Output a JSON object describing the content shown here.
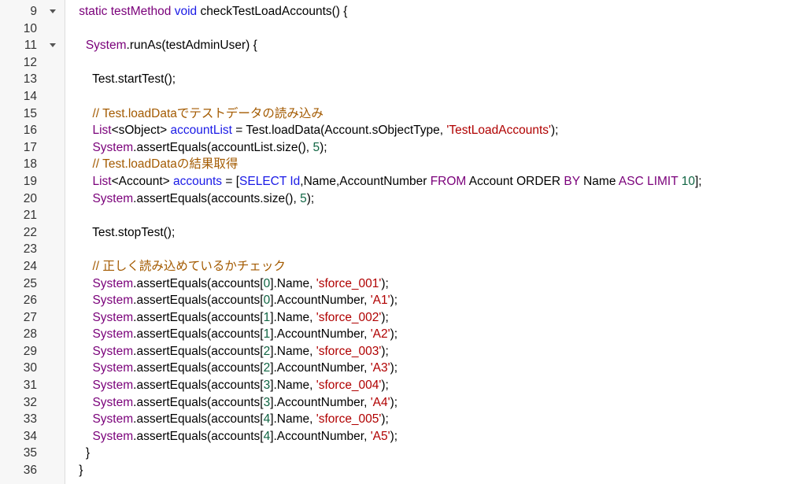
{
  "colors": {
    "keyword": "#7a007a",
    "identifier_blue": "#1a1ae6",
    "comment": "#a35a00",
    "string": "#b00000",
    "number": "#116644",
    "gutter_bg": "#f7f7f7"
  },
  "gutter": {
    "line_numbers": [
      "9",
      "10",
      "11",
      "12",
      "13",
      "14",
      "15",
      "16",
      "17",
      "18",
      "19",
      "20",
      "21",
      "22",
      "23",
      "24",
      "25",
      "26",
      "27",
      "28",
      "29",
      "30",
      "31",
      "32",
      "33",
      "34",
      "35",
      "36"
    ],
    "fold_markers": [
      0,
      2
    ]
  },
  "code_lines": [
    [
      {
        "t": "    "
      },
      {
        "t": "static testMethod ",
        "c": "kw"
      },
      {
        "t": "void ",
        "c": "blue"
      },
      {
        "t": "checkTestLoadAccounts() {"
      }
    ],
    [
      {
        "t": ""
      }
    ],
    [
      {
        "t": "      "
      },
      {
        "t": "System",
        "c": "kw"
      },
      {
        "t": ".runAs(testAdminUser) {"
      }
    ],
    [
      {
        "t": ""
      }
    ],
    [
      {
        "t": "        Test.startTest();"
      }
    ],
    [
      {
        "t": ""
      }
    ],
    [
      {
        "t": "        "
      },
      {
        "t": "// Test.loadDataでテストデータの読み込み",
        "c": "cm"
      }
    ],
    [
      {
        "t": "        "
      },
      {
        "t": "List",
        "c": "kw"
      },
      {
        "t": "<sObject> "
      },
      {
        "t": "accountList",
        "c": "blue"
      },
      {
        "t": " = Test.loadData(Account.sObjectType, "
      },
      {
        "t": "'TestLoadAccounts'",
        "c": "str"
      },
      {
        "t": ");"
      }
    ],
    [
      {
        "t": "        "
      },
      {
        "t": "System",
        "c": "kw"
      },
      {
        "t": ".assertEquals(accountList.size(), "
      },
      {
        "t": "5",
        "c": "numlit"
      },
      {
        "t": ");"
      }
    ],
    [
      {
        "t": "        "
      },
      {
        "t": "// Test.loadDataの結果取得",
        "c": "cm"
      }
    ],
    [
      {
        "t": "        "
      },
      {
        "t": "List",
        "c": "kw"
      },
      {
        "t": "<Account> "
      },
      {
        "t": "accounts",
        "c": "blue"
      },
      {
        "t": " = ["
      },
      {
        "t": "SELECT Id",
        "c": "blue"
      },
      {
        "t": ",Name,AccountNumber "
      },
      {
        "t": "FROM",
        "c": "kw"
      },
      {
        "t": " Account ORDER "
      },
      {
        "t": "BY",
        "c": "kw"
      },
      {
        "t": " Name "
      },
      {
        "t": "ASC LIMIT",
        "c": "kw"
      },
      {
        "t": " "
      },
      {
        "t": "10",
        "c": "numlit"
      },
      {
        "t": "];"
      }
    ],
    [
      {
        "t": "        "
      },
      {
        "t": "System",
        "c": "kw"
      },
      {
        "t": ".assertEquals(accounts.size(), "
      },
      {
        "t": "5",
        "c": "numlit"
      },
      {
        "t": ");"
      }
    ],
    [
      {
        "t": ""
      }
    ],
    [
      {
        "t": "        Test.stopTest();"
      }
    ],
    [
      {
        "t": ""
      }
    ],
    [
      {
        "t": "        "
      },
      {
        "t": "// 正しく読み込めているかチェック",
        "c": "cm"
      }
    ],
    [
      {
        "t": "        "
      },
      {
        "t": "System",
        "c": "kw"
      },
      {
        "t": ".assertEquals(accounts["
      },
      {
        "t": "0",
        "c": "numlit"
      },
      {
        "t": "].Name, "
      },
      {
        "t": "'sforce_001'",
        "c": "str"
      },
      {
        "t": ");"
      }
    ],
    [
      {
        "t": "        "
      },
      {
        "t": "System",
        "c": "kw"
      },
      {
        "t": ".assertEquals(accounts["
      },
      {
        "t": "0",
        "c": "numlit"
      },
      {
        "t": "].AccountNumber, "
      },
      {
        "t": "'A1'",
        "c": "str"
      },
      {
        "t": ");"
      }
    ],
    [
      {
        "t": "        "
      },
      {
        "t": "System",
        "c": "kw"
      },
      {
        "t": ".assertEquals(accounts["
      },
      {
        "t": "1",
        "c": "numlit"
      },
      {
        "t": "].Name, "
      },
      {
        "t": "'sforce_002'",
        "c": "str"
      },
      {
        "t": ");"
      }
    ],
    [
      {
        "t": "        "
      },
      {
        "t": "System",
        "c": "kw"
      },
      {
        "t": ".assertEquals(accounts["
      },
      {
        "t": "1",
        "c": "numlit"
      },
      {
        "t": "].AccountNumber, "
      },
      {
        "t": "'A2'",
        "c": "str"
      },
      {
        "t": ");"
      }
    ],
    [
      {
        "t": "        "
      },
      {
        "t": "System",
        "c": "kw"
      },
      {
        "t": ".assertEquals(accounts["
      },
      {
        "t": "2",
        "c": "numlit"
      },
      {
        "t": "].Name, "
      },
      {
        "t": "'sforce_003'",
        "c": "str"
      },
      {
        "t": ");"
      }
    ],
    [
      {
        "t": "        "
      },
      {
        "t": "System",
        "c": "kw"
      },
      {
        "t": ".assertEquals(accounts["
      },
      {
        "t": "2",
        "c": "numlit"
      },
      {
        "t": "].AccountNumber, "
      },
      {
        "t": "'A3'",
        "c": "str"
      },
      {
        "t": ");"
      }
    ],
    [
      {
        "t": "        "
      },
      {
        "t": "System",
        "c": "kw"
      },
      {
        "t": ".assertEquals(accounts["
      },
      {
        "t": "3",
        "c": "numlit"
      },
      {
        "t": "].Name, "
      },
      {
        "t": "'sforce_004'",
        "c": "str"
      },
      {
        "t": ");"
      }
    ],
    [
      {
        "t": "        "
      },
      {
        "t": "System",
        "c": "kw"
      },
      {
        "t": ".assertEquals(accounts["
      },
      {
        "t": "3",
        "c": "numlit"
      },
      {
        "t": "].AccountNumber, "
      },
      {
        "t": "'A4'",
        "c": "str"
      },
      {
        "t": ");"
      }
    ],
    [
      {
        "t": "        "
      },
      {
        "t": "System",
        "c": "kw"
      },
      {
        "t": ".assertEquals(accounts["
      },
      {
        "t": "4",
        "c": "numlit"
      },
      {
        "t": "].Name, "
      },
      {
        "t": "'sforce_005'",
        "c": "str"
      },
      {
        "t": ");"
      }
    ],
    [
      {
        "t": "        "
      },
      {
        "t": "System",
        "c": "kw"
      },
      {
        "t": ".assertEquals(accounts["
      },
      {
        "t": "4",
        "c": "numlit"
      },
      {
        "t": "].AccountNumber, "
      },
      {
        "t": "'A5'",
        "c": "str"
      },
      {
        "t": ");"
      }
    ],
    [
      {
        "t": "      }"
      }
    ],
    [
      {
        "t": "    }"
      }
    ]
  ]
}
